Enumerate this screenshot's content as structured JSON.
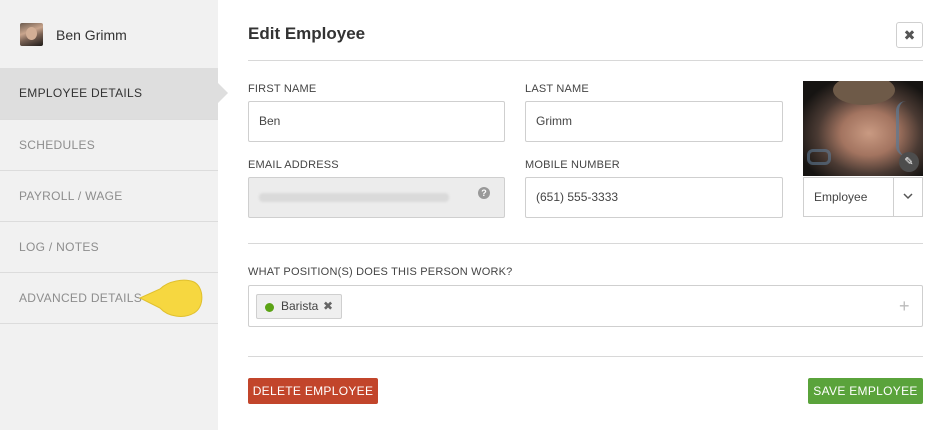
{
  "user": {
    "name": "Ben Grimm"
  },
  "sidebar": {
    "items": [
      {
        "label": "EMPLOYEE DETAILS",
        "active": true
      },
      {
        "label": "SCHEDULES"
      },
      {
        "label": "PAYROLL / WAGE"
      },
      {
        "label": "LOG / NOTES"
      },
      {
        "label": "ADVANCED DETAILS"
      }
    ]
  },
  "form": {
    "title": "Edit Employee",
    "first_name_label": "FIRST NAME",
    "first_name_value": "Ben",
    "last_name_label": "LAST NAME",
    "last_name_value": "Grimm",
    "email_label": "EMAIL ADDRESS",
    "mobile_label": "MOBILE NUMBER",
    "mobile_value": "(651) 555-3333",
    "role_value": "Employee",
    "positions_label": "WHAT POSITION(S) DOES THIS PERSON WORK?",
    "positions": [
      {
        "label": "Barista",
        "color": "#5ba315"
      }
    ],
    "help_icon": "?"
  },
  "actions": {
    "delete_label": "DELETE EMPLOYEE",
    "save_label": "SAVE EMPLOYEE"
  },
  "colors": {
    "delete": "#c2452b",
    "save": "#5aa33b",
    "tooltip": "#f6d740",
    "sidebar_active": "#dedede"
  },
  "icons": {
    "close": "close-icon",
    "edit": "pencil-icon",
    "dropdown": "chevron-down-icon",
    "remove_tag": "remove-tag-icon",
    "add": "plus-icon",
    "help": "help-icon"
  }
}
